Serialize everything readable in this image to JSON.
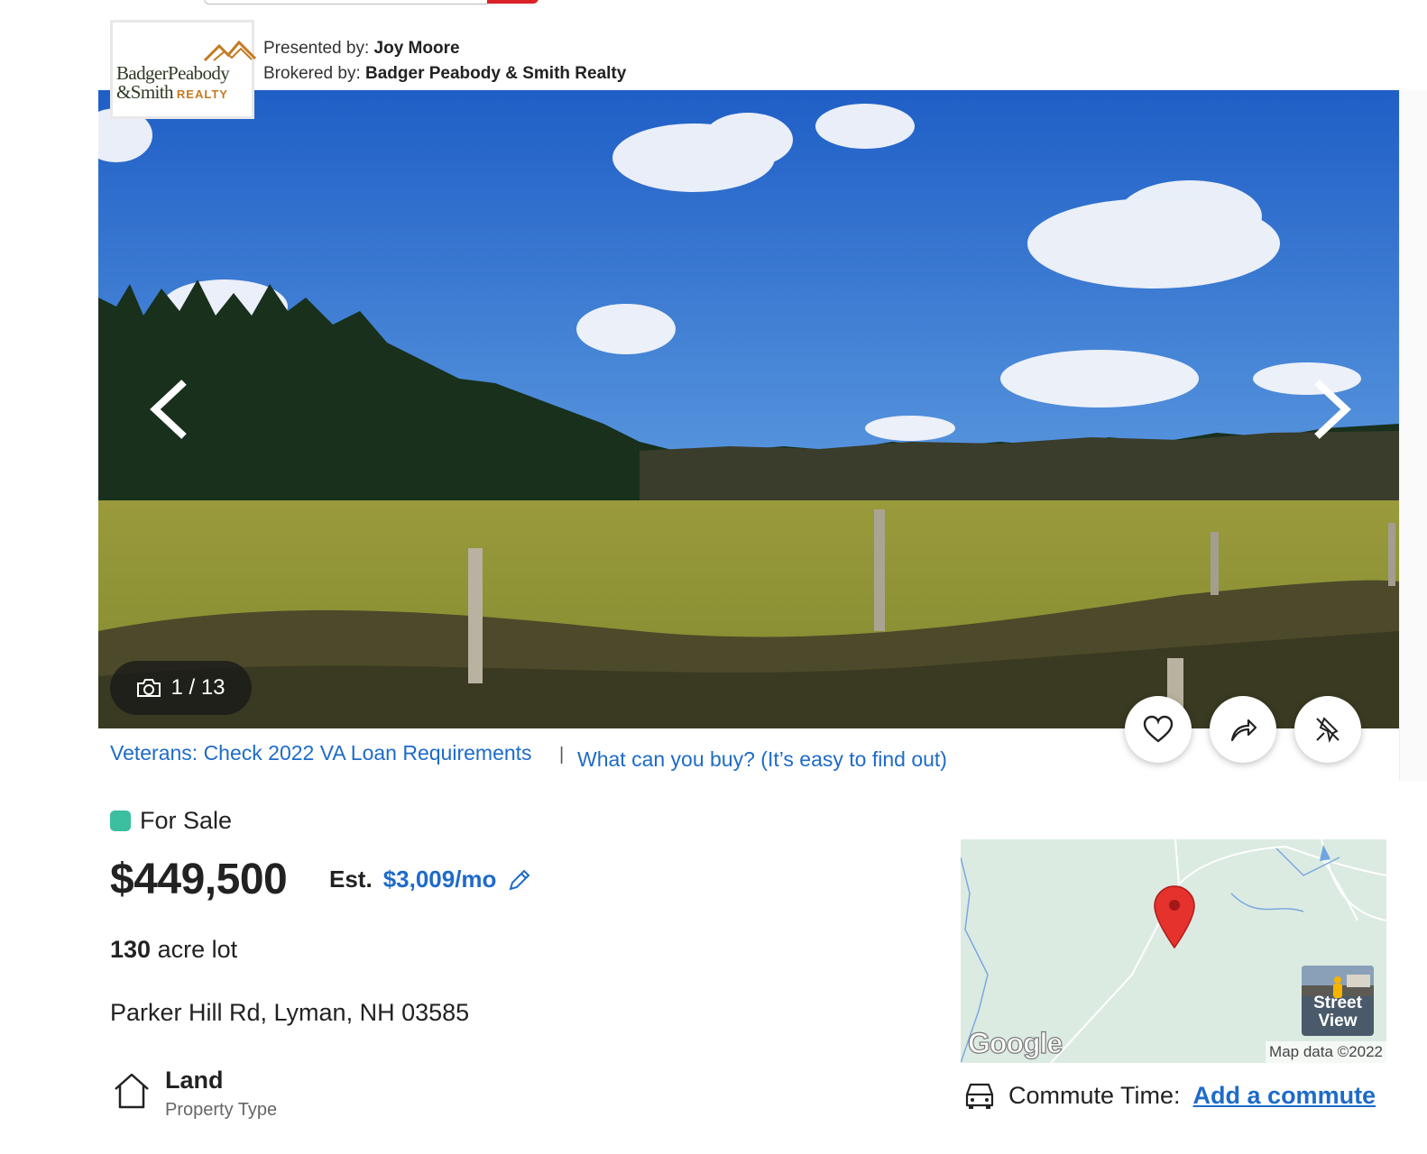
{
  "listing_header": {
    "presented_by_label": "Presented by:",
    "presented_by_name": "Joy Moore",
    "brokered_by_label": "Brokered by:",
    "brokered_by_name": "Badger Peabody & Smith Realty",
    "logo_line1": "BadgerPeabody",
    "logo_line2": "&Smith",
    "logo_realty": "REALTY"
  },
  "gallery": {
    "counter": "1 / 13"
  },
  "links": {
    "va_loan": "Veterans: Check 2022 VA Loan Requirements",
    "separator": "|",
    "buy_power": "What can you buy? (It’s easy to find out)"
  },
  "summary": {
    "status": "For Sale",
    "price": "$449,500",
    "est_label": "Est.",
    "est_payment": "$3,009/mo",
    "lot_size_value": "130",
    "lot_size_unit": "acre lot",
    "address": "Parker Hill Rd, Lyman, NH 03585",
    "property_type": "Land",
    "property_type_label": "Property Type"
  },
  "map": {
    "street_view_line1": "Street",
    "street_view_line2": "View",
    "attribution": "Map data ©2022",
    "google_label": "Google"
  },
  "commute": {
    "label": "Commute Time:",
    "link": "Add a commute"
  },
  "colors": {
    "status_dot": "#3bbfa0",
    "link_blue": "#1e6bc9",
    "brand_red": "#d92228"
  }
}
